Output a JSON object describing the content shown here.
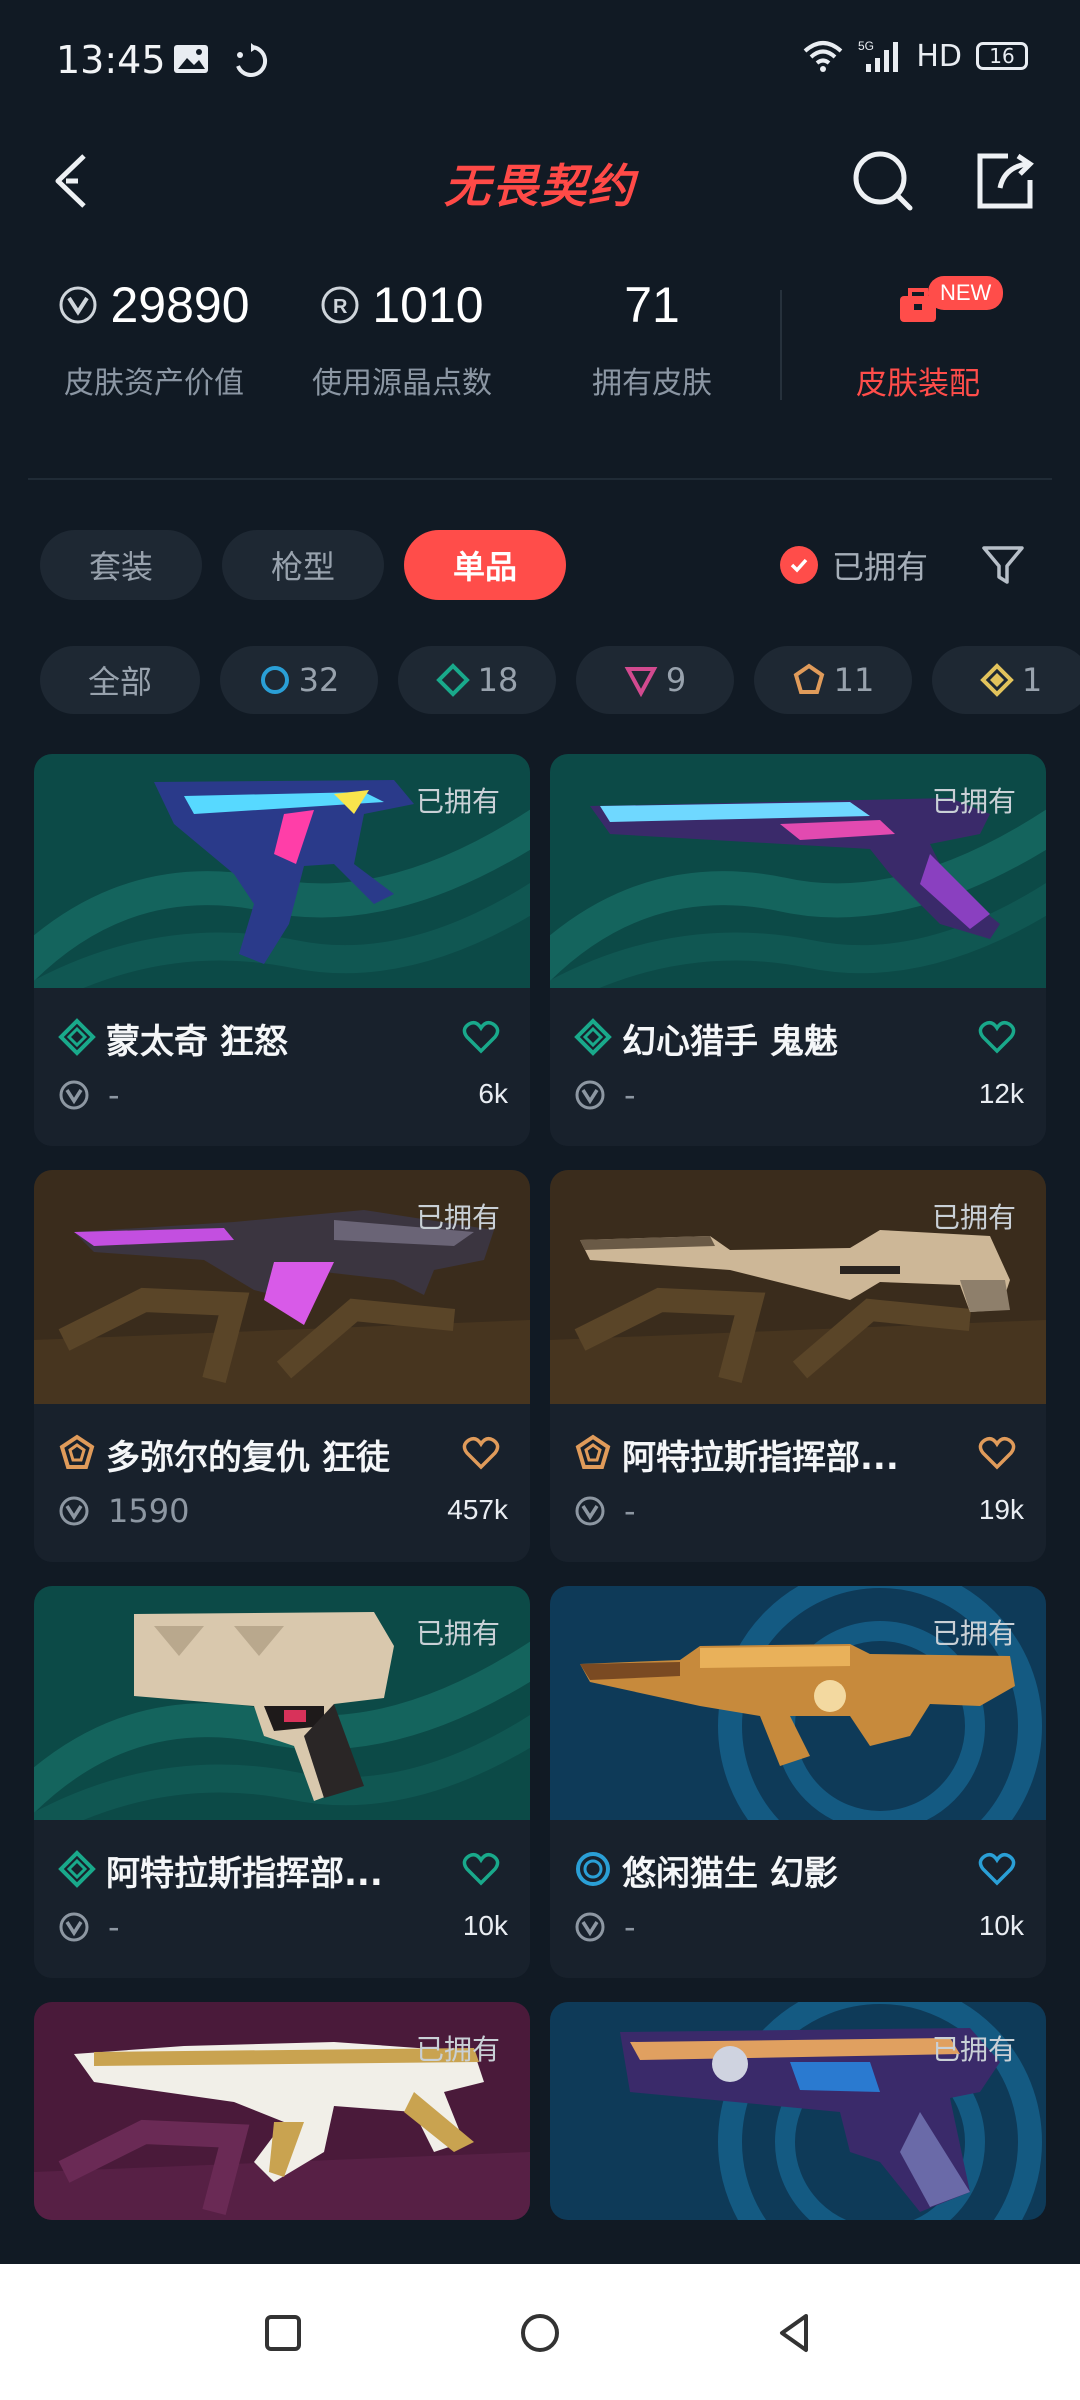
{
  "status_bar": {
    "time": "13:45",
    "network": "HD",
    "battery": "16"
  },
  "header": {
    "title": "无畏契约"
  },
  "stats": [
    {
      "value": "29890",
      "label": "皮肤资产价值",
      "icon": "vp-icon"
    },
    {
      "value": "1010",
      "label": "使用源晶点数",
      "icon": "radianite-icon"
    },
    {
      "value": "71",
      "label": "拥有皮肤",
      "icon": ""
    }
  ],
  "loadout": {
    "label": "皮肤装配",
    "badge": "NEW"
  },
  "tabs": [
    {
      "label": "套装",
      "active": false
    },
    {
      "label": "枪型",
      "active": false
    },
    {
      "label": "单品",
      "active": true
    }
  ],
  "owned_filter": {
    "label": "已拥有",
    "checked": true
  },
  "tiers": [
    {
      "label": "全部",
      "count": "",
      "color": ""
    },
    {
      "label": "",
      "count": "32",
      "color": "#2a9fd6"
    },
    {
      "label": "",
      "count": "18",
      "color": "#19a98b"
    },
    {
      "label": "",
      "count": "9",
      "color": "#d24a8f"
    },
    {
      "label": "",
      "count": "11",
      "color": "#e09b5a"
    },
    {
      "label": "",
      "count": "1",
      "color": "#e2c35c"
    }
  ],
  "cards": [
    {
      "name": "蒙太奇 狂怒",
      "price": "-",
      "likes": "6k",
      "owned": "已拥有",
      "tier_color": "#19a98b",
      "bg": "teal"
    },
    {
      "name": "幻心猎手 鬼魅",
      "price": "-",
      "likes": "12k",
      "owned": "已拥有",
      "tier_color": "#19a98b",
      "bg": "teal"
    },
    {
      "name": "多弥尔的复仇 狂徒",
      "price": "1590",
      "likes": "457k",
      "owned": "已拥有",
      "tier_color": "#e09b5a",
      "bg": "brown"
    },
    {
      "name": "阿特拉斯指挥部...",
      "price": "-",
      "likes": "19k",
      "owned": "已拥有",
      "tier_color": "#e09b5a",
      "bg": "brown"
    },
    {
      "name": "阿特拉斯指挥部...",
      "price": "-",
      "likes": "10k",
      "owned": "已拥有",
      "tier_color": "#19a98b",
      "bg": "teal"
    },
    {
      "name": "悠闲猫生 幻影",
      "price": "-",
      "likes": "10k",
      "owned": "已拥有",
      "tier_color": "#2a9fd6",
      "bg": "blue"
    },
    {
      "name": "",
      "price": "",
      "likes": "",
      "owned": "已拥有",
      "tier_color": "",
      "bg": "purple"
    },
    {
      "name": "",
      "price": "",
      "likes": "",
      "owned": "已拥有",
      "tier_color": "",
      "bg": "blue"
    }
  ]
}
